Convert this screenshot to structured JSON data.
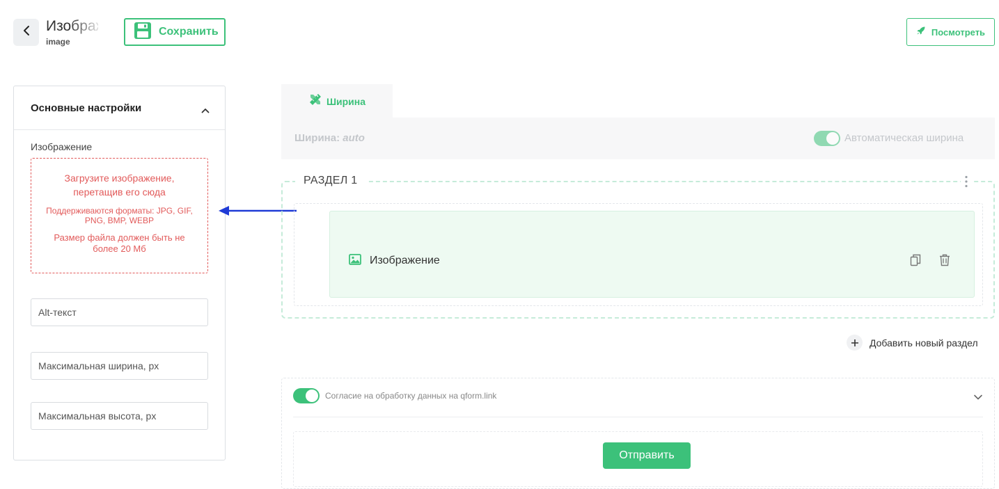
{
  "header": {
    "title": "Изображение",
    "subtitle": "image",
    "save_label": "Сохранить",
    "view_label": "Посмотреть"
  },
  "left_panel": {
    "section_title": "Основные настройки",
    "image_label": "Изображение",
    "dropzone": {
      "main_text": "Загрузите изображение, перетащив его сюда",
      "formats_text": "Поддерживаются форматы: JPG, GIF, PNG, BMP, WEBP",
      "size_text": "Размер файла должен быть не более 20 Мб"
    },
    "fields": {
      "alt_placeholder": "Alt-текст",
      "max_width_placeholder": "Максимальная ширина, px",
      "max_height_placeholder": "Максимальная высота, px"
    }
  },
  "tabs": [
    {
      "label": "Ширина",
      "icon": "ruler-pencil-icon",
      "active": true
    }
  ],
  "width_bar": {
    "label": "Ширина:",
    "value": "auto",
    "auto_label": "Автоматическая ширина",
    "auto_enabled": true
  },
  "section": {
    "title": "РАЗДЕЛ 1",
    "block_label": "Изображение"
  },
  "add_section_label": "Добавить новый раздел",
  "consent": {
    "label": "Согласие на обработку данных на qform.link",
    "enabled": true
  },
  "submit_label": "Отправить",
  "colors": {
    "accent": "#3cc17a",
    "error": "#e25a5a",
    "arrow": "#1f3bd6"
  }
}
